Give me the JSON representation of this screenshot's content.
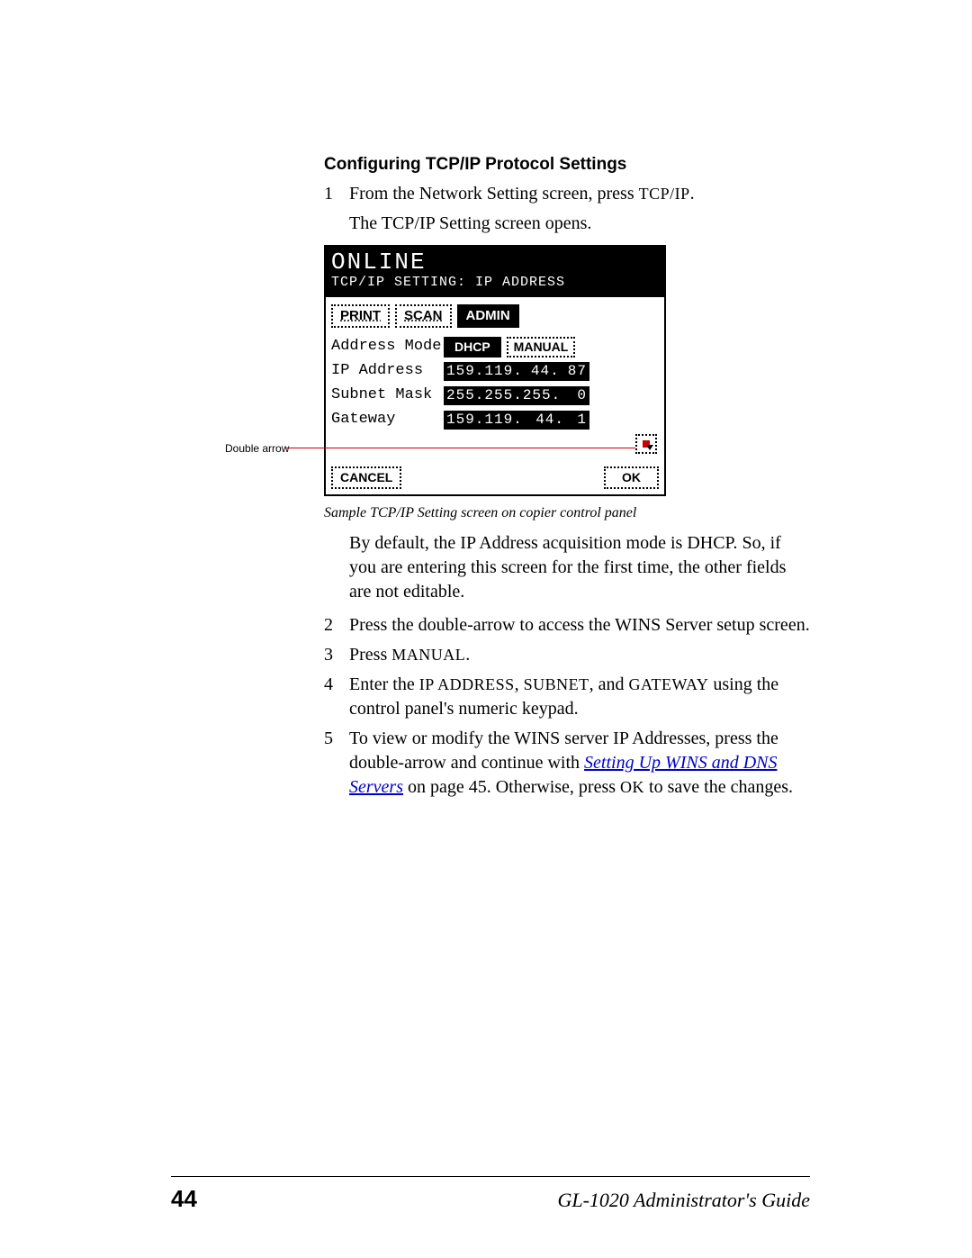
{
  "heading": "Configuring TCP/IP Protocol Settings",
  "step1": {
    "num": "1",
    "line1a": "From the Network Setting screen, press ",
    "line1b": "TCP/IP",
    "line1c": ".",
    "line2": "The TCP/IP Setting screen opens."
  },
  "callout": "Double arrow",
  "lcd": {
    "online": "ONLINE",
    "subtitle": "TCP/IP SETTING: IP ADDRESS",
    "tabs": {
      "print": "PRINT",
      "scan": "SCAN",
      "admin": "ADMIN"
    },
    "rows": {
      "addrmode_label": "Address Mode",
      "dhcp": "DHCP",
      "manual": "MANUAL",
      "ip_label": "IP Address",
      "ip_a": "159.119.",
      "ip_b": "44.",
      "ip_c": "87",
      "sm_label": "Subnet Mask",
      "sm_a": "255.255.255.",
      "sm_b": "0",
      "gw_label": "Gateway",
      "gw_a": "159.119.",
      "gw_b": "44.",
      "gw_c": "1"
    },
    "cancel": "CANCEL",
    "ok": "OK"
  },
  "caption": "Sample TCP/IP Setting screen on copier control panel",
  "para_after": "By default, the IP Address acquisition mode is DHCP. So, if you are entering this screen for the first time, the other fields are not editable.",
  "step2": {
    "num": "2",
    "text": "Press the double-arrow to access the WINS Server setup screen."
  },
  "step3": {
    "num": "3",
    "pre": "Press ",
    "btn": "MANUAL",
    "post": "."
  },
  "step4": {
    "num": "4",
    "a": "Enter the ",
    "ip": "IP ADDRESS",
    "b": ", ",
    "sub": "SUBNET",
    "c": ", and ",
    "gw": "GATEWAY",
    "d": " using the control panel's numeric keypad."
  },
  "step5": {
    "num": "5",
    "a": "To view or modify the WINS server IP Addresses, press the double-arrow and continue with ",
    "link": "Setting Up WINS and DNS Servers",
    "b": " on page 45. Otherwise, press ",
    "ok": "OK",
    "c": " to save the changes."
  },
  "footer": {
    "page": "44",
    "guide": "GL-1020 Administrator's Guide"
  }
}
